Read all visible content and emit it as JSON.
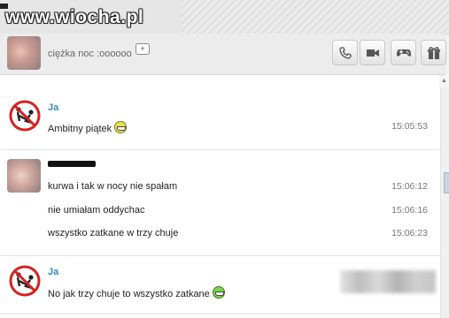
{
  "watermark": "www.wiocha.pl",
  "header": {
    "status": "ciężka noc :oooooo",
    "buttons": [
      {
        "name": "phone-button",
        "icon": "phone-icon"
      },
      {
        "name": "video-button",
        "icon": "video-camera-icon"
      },
      {
        "name": "game-button",
        "icon": "gamepad-icon"
      },
      {
        "name": "gift-button",
        "icon": "gift-icon"
      }
    ]
  },
  "messages": [
    {
      "sender": "Ja",
      "lines": [
        {
          "text": "Ambitny piątek",
          "time": "15:05:53",
          "emoji": "grin"
        }
      ]
    },
    {
      "sender": "",
      "lines": [
        {
          "text": "kurwa i tak w nocy nie spałam",
          "time": "15:06:12"
        },
        {
          "text": "nie umiałam oddychac",
          "time": "15:06:16"
        },
        {
          "text": "wszystko zatkane w trzy chuje",
          "time": "15:06:23"
        }
      ]
    },
    {
      "sender": "Ja",
      "lines": [
        {
          "text": "No jak trzy chuje to wszystko zatkane",
          "time": "",
          "emoji": "grin-green"
        }
      ]
    }
  ],
  "colors": {
    "sender": "#3b86c6",
    "accent_red": "#d62020"
  }
}
